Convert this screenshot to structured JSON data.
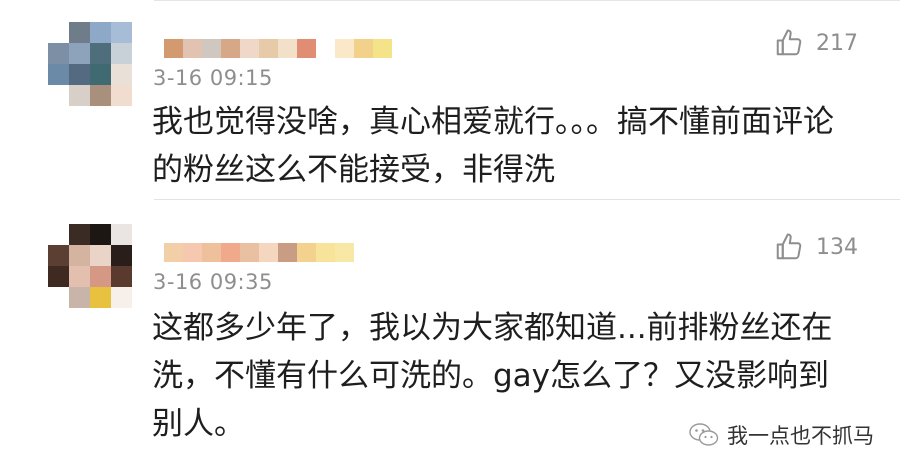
{
  "comments": [
    {
      "time": "3-16 09:15",
      "likes": "217",
      "text": "我也觉得没啥，真心相爱就行。。。搞不懂前面评论的粉丝这么不能接受，非得洗",
      "avatar_colors": [
        "#ffffff",
        "#6f7d8a",
        "#8ea9c8",
        "#a7bcd6",
        "#7d8fa4",
        "#8da2bb",
        "#4d6e7a",
        "#c8d0d8",
        "#6a8aa7",
        "#536a80",
        "#3f6a72",
        "#e9e0d8",
        "#ffffff",
        "#d8d0c8",
        "#a9907c",
        "#f1dcd0"
      ],
      "name_colors": [
        "#d49a6f",
        "#e2c2b0",
        "#cfc7c0",
        "#d7a887",
        "#f0d8c8",
        "#e7caa8",
        "#f3e0c9",
        "#e08d74",
        "#ffffff",
        "#fae8c9",
        "#f2d28a",
        "#f5e38a"
      ]
    },
    {
      "time": "3-16 09:35",
      "likes": "134",
      "text": "这都多少年了，我以为大家都知道...前排粉丝还在洗，不懂有什么可洗的。gay怎么了？又没影响到别人。",
      "avatar_colors": [
        "#ffffff",
        "#3a2b24",
        "#1d1714",
        "#eae5e2",
        "#5b3f33",
        "#d5b3a1",
        "#e9d4c7",
        "#2a1e1a",
        "#3f2a22",
        "#e2bfae",
        "#d49884",
        "#5a3a2d",
        "#ffffff",
        "#c9b4a9",
        "#e8c23e",
        "#f7f0ea"
      ],
      "name_colors": [
        "#f3cfa8",
        "#f6c8b0",
        "#eec19c",
        "#f1a98c",
        "#e9c0a2",
        "#f5d7bf",
        "#c99c84",
        "#f3d28f",
        "#f7e39a",
        "#f9e7a6"
      ]
    }
  ],
  "watermark": {
    "icon": "wechat-icon",
    "text": "我一点也不抓马"
  }
}
